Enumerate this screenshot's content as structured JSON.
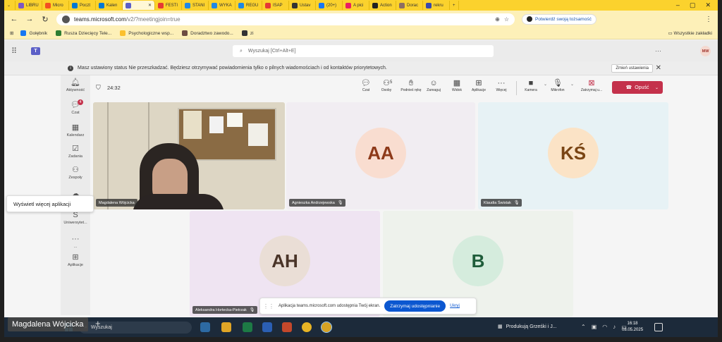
{
  "browser": {
    "tabs": [
      {
        "label": "LIBRU",
        "color": "#7e57c2"
      },
      {
        "label": "Micro",
        "color": "#f25022"
      },
      {
        "label": "Poczt",
        "color": "#0078d4"
      },
      {
        "label": "Kalen",
        "color": "#0078d4"
      },
      {
        "label": "",
        "color": "#5b5fc7",
        "active": true
      },
      {
        "label": "FESTI",
        "color": "#e53935"
      },
      {
        "label": "STANI",
        "color": "#1e88e5"
      },
      {
        "label": "WYKA",
        "color": "#1e88e5"
      },
      {
        "label": "REGU",
        "color": "#1e88e5"
      },
      {
        "label": "ISAP",
        "color": "#e53935"
      },
      {
        "label": "Ustav",
        "color": "#333333"
      },
      {
        "label": "(20+)",
        "color": "#1877f2"
      },
      {
        "label": "A pici",
        "color": "#e91e63"
      },
      {
        "label": "Action",
        "color": "#222222"
      },
      {
        "label": "Dorac",
        "color": "#8d6e63"
      },
      {
        "label": "rekru",
        "color": "#3949ab"
      }
    ],
    "url_host": "teams.microsoft.com",
    "url_path": "/v2/?meetingjoin=true",
    "verify_label": "Potwierdź swoją tożsamość",
    "bookmarks": [
      {
        "label": "Gołębnik",
        "color": "#1877f2"
      },
      {
        "label": "Rusza Dziecięcy Tele...",
        "color": "#2e7d32"
      },
      {
        "label": "Psychologiczne wsp...",
        "color": "#fbc02d"
      },
      {
        "label": "Doradztwo zawodo...",
        "color": "#6d4c41"
      },
      {
        "label": "zi",
        "color": "#333333"
      }
    ],
    "all_bookmarks": "Wszystkie zakładki"
  },
  "teams": {
    "search_placeholder": "Wyszukaj [Ctrl+Alt+E]",
    "avatar": "MW",
    "banner_text": "Masz ustawiony status Nie przeszkadzać. Będziesz otrzymywać powiadomienia tylko o pilnych wiadomościach i od kontaktów priorytetowych.",
    "banner_button": "Zmień ustawienia",
    "rail": [
      {
        "label": "Aktywność",
        "icon": "bell-icon"
      },
      {
        "label": "Czat",
        "icon": "chat-icon",
        "badge": "4"
      },
      {
        "label": "Kalendarz",
        "icon": "calendar-icon"
      },
      {
        "label": "Zadania",
        "icon": "tasks-icon"
      },
      {
        "label": "Zespoły",
        "icon": "teams-icon"
      },
      {
        "label": "",
        "icon": "cloud-icon"
      },
      {
        "label": "Uniwersytet...",
        "icon": "school-icon"
      },
      {
        "label": "...",
        "icon": "more-icon"
      },
      {
        "label": "Aplikacje",
        "icon": "apps-icon"
      }
    ],
    "tooltip": "Wyświetl więcej aplikacji"
  },
  "meeting": {
    "timer": "24:32",
    "toolbar": [
      {
        "label": "Czat",
        "icon": "chat-icon"
      },
      {
        "label": "Osoby",
        "icon": "people-icon",
        "count": "5"
      },
      {
        "label": "Podnieś rękę",
        "icon": "hand-icon"
      },
      {
        "label": "Zareaguj",
        "icon": "smile-icon"
      },
      {
        "label": "Widok",
        "icon": "grid-view-icon"
      },
      {
        "label": "Aplikacje",
        "icon": "plus-icon"
      },
      {
        "label": "Więcej",
        "icon": "more-icon"
      },
      {
        "label": "Kamera",
        "icon": "camera-icon"
      },
      {
        "label": "Mikrofon",
        "icon": "mic-icon"
      },
      {
        "label": "Zatrzymaj u...",
        "icon": "stop-share-icon"
      }
    ],
    "leave_label": "Opuść",
    "participants": [
      {
        "name": "Magdalena Wójcicka",
        "initials": "",
        "video": true
      },
      {
        "name": "Agnieszka Andrzejewska",
        "initials": "AA",
        "bg": "#f9ddd0",
        "fg": "#8e3a1a",
        "tile": "#f1edf2"
      },
      {
        "name": "Klaudia Świstak",
        "initials": "KŚ",
        "bg": "#fbe3c6",
        "fg": "#7a4514",
        "tile": "#e7f2f5"
      },
      {
        "name": "Aleksandra Hortecka-Pietrzak",
        "initials": "AH",
        "bg": "#eaded6",
        "fg": "#4a3428",
        "tile": "#efe4f2"
      },
      {
        "name": "",
        "initials": "B",
        "bg": "#d5ecdd",
        "fg": "#1f5d3a",
        "tile": "#eef2ec"
      }
    ]
  },
  "share_bar": {
    "text": "Aplikacja teams.microsoft.com udostępnia Twój ekran.",
    "stop_label": "Zatrzymaj udostępnianie",
    "hide_label": "Ukryj"
  },
  "taskbar": {
    "search_placeholder": "Wyszukaj",
    "task_label": "Produkują Grześki i J...",
    "time": "16:18",
    "date": "08.05.2025"
  },
  "presenter_name": "Magdalena Wójcicka"
}
